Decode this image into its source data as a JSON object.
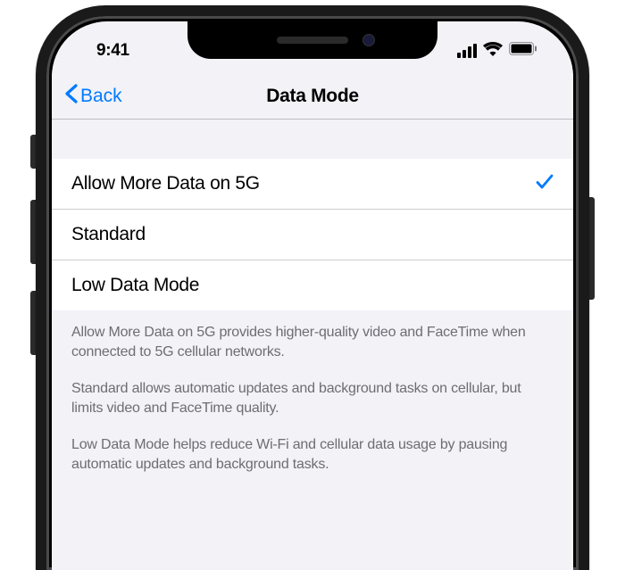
{
  "status": {
    "time": "9:41"
  },
  "nav": {
    "back_label": "Back",
    "title": "Data Mode"
  },
  "options": [
    {
      "label": "Allow More Data on 5G",
      "selected": true
    },
    {
      "label": "Standard",
      "selected": false
    },
    {
      "label": "Low Data Mode",
      "selected": false
    }
  ],
  "footer": {
    "p1": "Allow More Data on 5G provides higher-quality video and FaceTime when connected to 5G cellular networks.",
    "p2": "Standard allows automatic updates and background tasks on cellular, but limits video and FaceTime quality.",
    "p3": "Low Data Mode helps reduce Wi-Fi and cellular data usage by pausing automatic updates and background tasks."
  },
  "colors": {
    "accent": "#007AFF",
    "group_bg": "#f2f2f7",
    "separator": "rgba(60,60,67,0.29)",
    "secondary_text": "#6d6d72"
  }
}
